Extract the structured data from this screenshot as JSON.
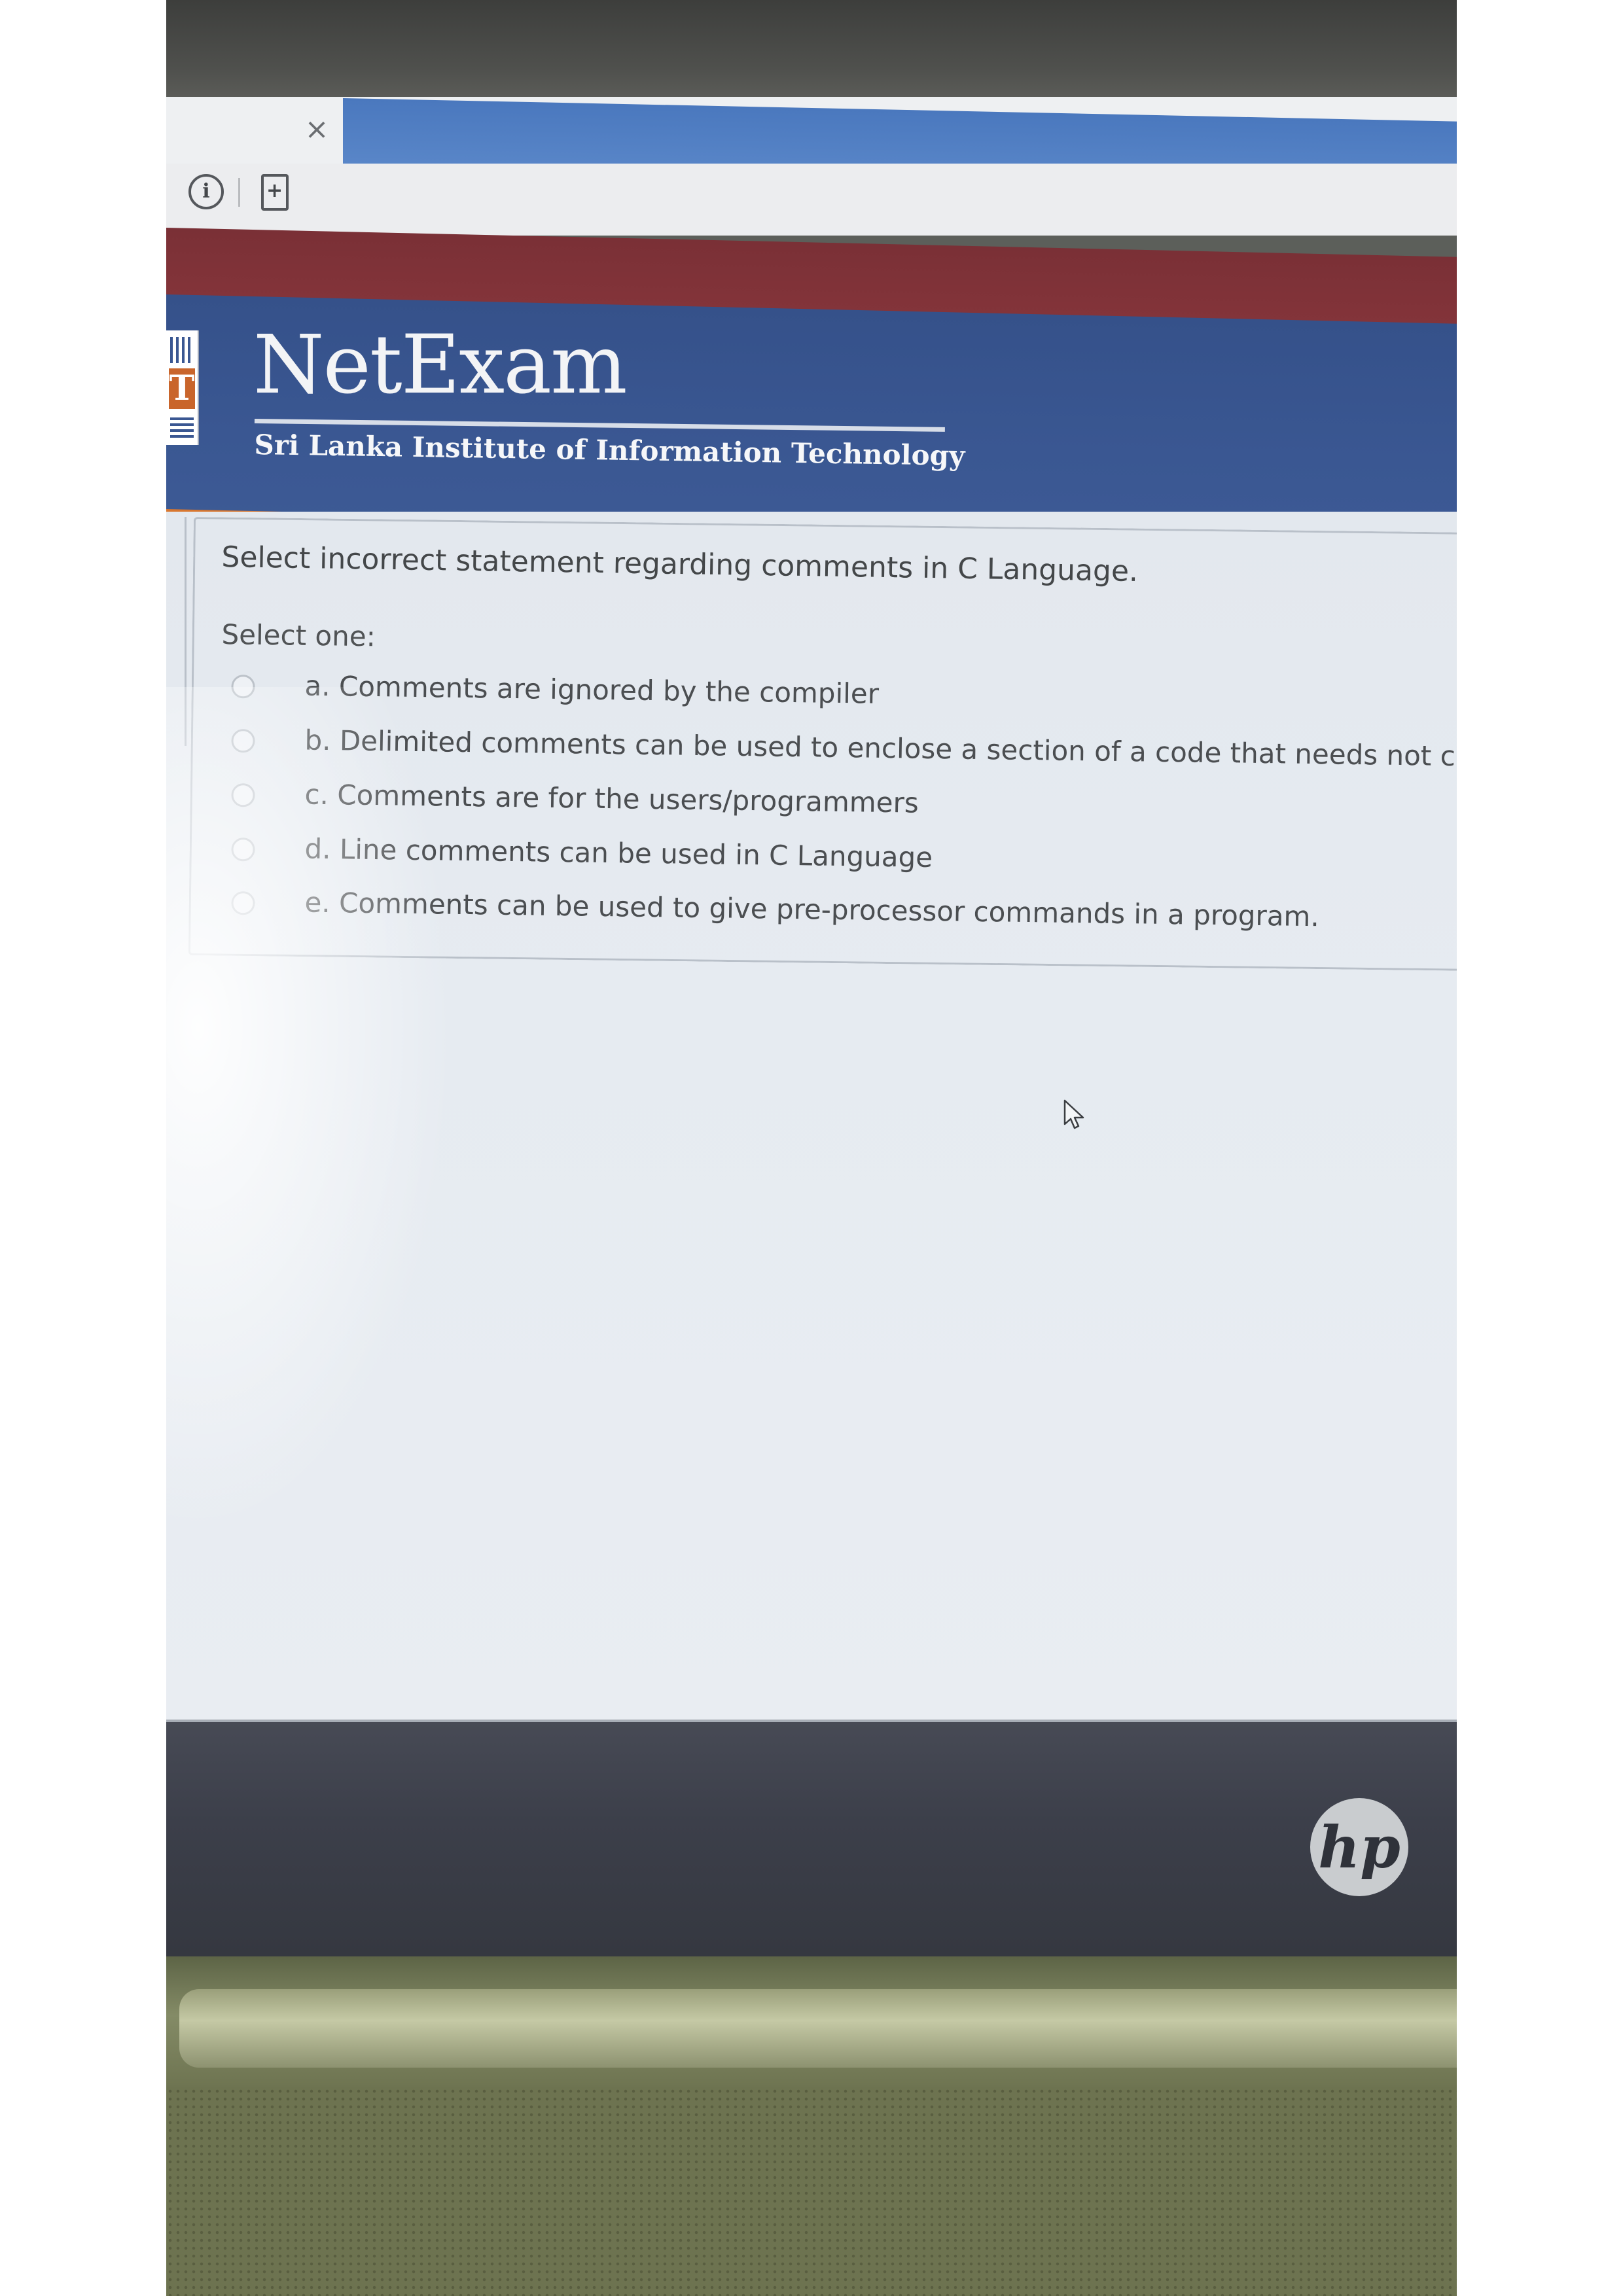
{
  "browser": {
    "tab_close_glyph": "×",
    "info_glyph": "i"
  },
  "site": {
    "brand": "NetExam",
    "institute": "Sri Lanka Institute of Information Technology",
    "logo_letter": "T"
  },
  "quiz": {
    "question": "Select incorrect statement regarding comments in C Language.",
    "prompt": "Select one:",
    "options": [
      {
        "label": "a. Comments are ignored by the compiler",
        "selected": false
      },
      {
        "label": "b. Delimited comments can be used to enclose a section of a code that needs not compiled",
        "selected": false
      },
      {
        "label": "c. Comments are for the users/programmers",
        "selected": false
      },
      {
        "label": "d. Line comments can be used in C Language",
        "selected": false
      },
      {
        "label": "e. Comments can be used to give pre-processor commands in a program.",
        "selected": false
      }
    ]
  },
  "laptop": {
    "brand_logo": "hp"
  },
  "colors": {
    "header_blue": "#3a5792",
    "header_red": "#84343a",
    "accent_orange": "#d9772f"
  }
}
